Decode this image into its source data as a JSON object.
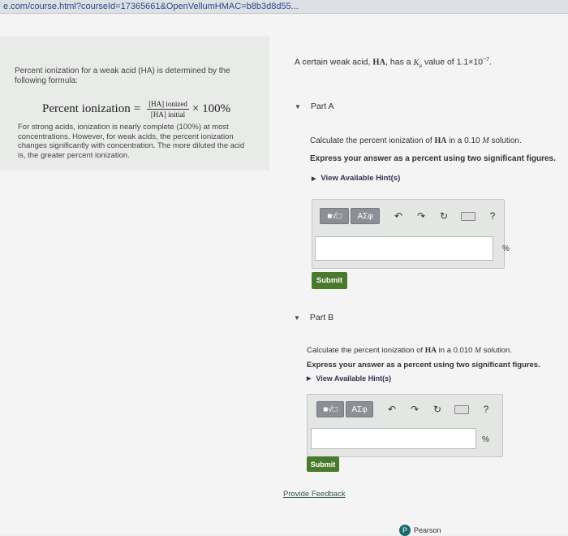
{
  "browser": {
    "url": "e.com/course.html?courseId=17365661&OpenVellumHMAC=b8b3d8d55..."
  },
  "left": {
    "intro": "Percent ionization for a weak acid (HA) is determined by the following formula:",
    "formula_label": "Percent ionization",
    "formula_num": "[HA] ionized",
    "formula_den": "[HA] initial",
    "formula_tail": "× 100%",
    "notes": "For strong acids, ionization is nearly complete (100%) at most concentrations. However, for weak acids, the percent ionization changes significantly with concentration. The more diluted the acid is, the greater percent ionization."
  },
  "right": {
    "statement_pre": "A certain weak acid,",
    "statement_ha": "HA",
    "statement_mid": ", has a",
    "statement_ka": "K",
    "statement_ka_sub": "a",
    "statement_post": "value of 1.1×10",
    "statement_exp": "−7",
    "statement_end": "."
  },
  "partA": {
    "title": "Part A",
    "q_pre": "Calculate the percent ionization of",
    "q_ha": "HA",
    "q_mid": "in a 0.10",
    "q_unit": "M",
    "q_post": "solution.",
    "instruction": "Express your answer as a percent using two significant figures.",
    "hint": "View Available Hint(s)",
    "answer_value": "",
    "unit": "%",
    "submit": "Submit"
  },
  "partB": {
    "title": "Part B",
    "q_pre": "Calculate the percent ionization of",
    "q_ha": "HA",
    "q_mid": "in a 0.010",
    "q_unit": "M",
    "q_post": "solution.",
    "instruction": "Express your answer as a percent using two significant figures.",
    "hint": "View Available Hint(s)",
    "answer_value": "",
    "unit": "%",
    "submit": "Submit"
  },
  "toolbar": {
    "template_btn": "■√□",
    "symbols_btn": "ΑΣφ",
    "help": "?"
  },
  "icons": {
    "undo": "undo-icon",
    "redo": "redo-icon",
    "reset": "reset-icon",
    "keyboard": "keyboard-icon",
    "help": "help-icon"
  },
  "footer": {
    "feedback": "Provide Feedback",
    "brand": "Pearson"
  },
  "colors": {
    "submit": "#4a7a2c",
    "toolbar_button": "#8c9096",
    "link": "#355"
  }
}
